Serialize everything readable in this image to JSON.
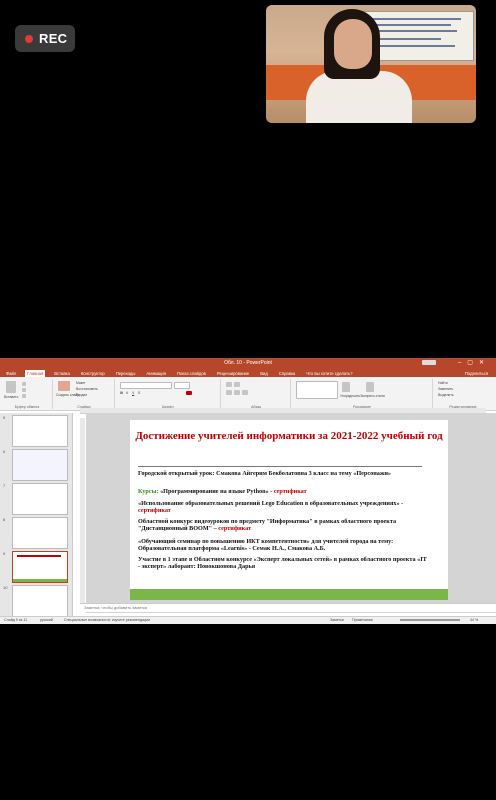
{
  "recording": {
    "label": "REC"
  },
  "window": {
    "title": "Обл. 10 - PowerPoint"
  },
  "menu": {
    "tabs": [
      "Файл",
      "Главная",
      "Вставка",
      "Конструктор",
      "Переходы",
      "Анимация",
      "Показ слайдов",
      "Рецензирование",
      "Вид",
      "Справка"
    ],
    "search": "Что вы хотите сделать?",
    "share": "Поделиться"
  },
  "ribbon": {
    "groups": [
      "Буфер обмена",
      "Слайды",
      "Шрифт",
      "Абзац",
      "Рисование",
      "Редактирование"
    ],
    "paste": "Вставить",
    "new_slide": "Создать слайд",
    "layout": "Макет",
    "reset": "Восстановить",
    "section": "Раздел",
    "arrange": "Упорядочить",
    "quick_styles": "Экспресс-стили",
    "find": "Найти",
    "replace": "Заменить",
    "select": "Выделить"
  },
  "thumbnails": {
    "numbers": [
      "5",
      "6",
      "7",
      "8",
      "9",
      "10"
    ],
    "selected": "9"
  },
  "slide": {
    "title": "Достижение учителей информатики за 2021-2022 учебный год",
    "p1": "Городской открытый урок: Смакова Айгерим Бекболатовна 3 класс на тему «Персонажи»",
    "p2_label": "Курсы:",
    "p2_text": " «Программирование на языке Python» - ",
    "p2_cert": "сертификат",
    "p3_text": "«Использование образовательных решений Lego Education в образовательных учреждениях»        - ",
    "p3_cert": "сертификат",
    "p4_text": "Областной конкурс видеоуроков по предмету \"Информатика\" в рамках областного проекта \"Дистанционный BOOM\" – ",
    "p4_cert": "сертификат",
    "p5": "«Обучающий семинар по повышению ИКТ компетентности» для учителей города на тему: Образовательная платформа «Learnis» - Семак Н.А., Смакова А.Б.",
    "p6": "Участие в 1 этапе в Областном конкурсе «Эксперт локальных сетей» в рамках областного проекта «IT - эксперт» лаборант: Новокшонова Дарья"
  },
  "notes": {
    "placeholder": "Заметки, чтобы добавить заметки"
  },
  "status": {
    "slide_count": "Слайд 9 из 11",
    "language": "русский",
    "accessibility": "Специальные возможности: изучите рекомендации",
    "notes_btn": "Заметки",
    "comments_btn": "Примечания",
    "zoom": "44 %"
  }
}
